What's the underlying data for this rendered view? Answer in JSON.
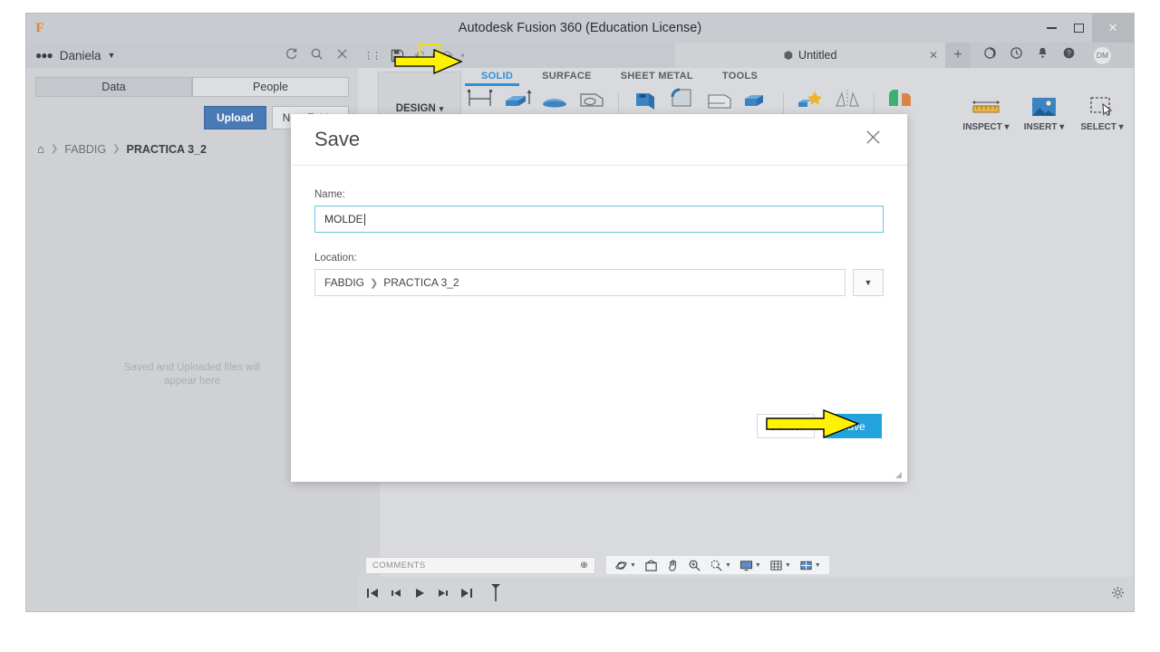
{
  "window": {
    "title": "Autodesk Fusion 360 (Education License)",
    "logo": "F",
    "minimize": "—",
    "maximize": "□",
    "close": "✕"
  },
  "data_panel": {
    "user": "Daniela",
    "user_caret": "▼",
    "people_icon": "people-icon",
    "refresh_icon": "refresh-icon",
    "search_icon": "search-icon",
    "close_icon": "close-icon",
    "tabs": [
      {
        "label": "Data",
        "active": true
      },
      {
        "label": "People",
        "active": false
      }
    ],
    "upload_label": "Upload",
    "new_folder_label": "New Folder",
    "breadcrumb": {
      "home": "⌂",
      "sep": "❯",
      "items": [
        "FABDIG",
        "PRACTICA 3_2"
      ]
    },
    "empty_line1": "Saved and Uploaded files will",
    "empty_line2": "appear here"
  },
  "quick_access": {
    "grip": "⋮⋮",
    "save_icon": "save-icon",
    "undo_label": "↶",
    "redo_label": "↷",
    "caret": "▾"
  },
  "doc_tabs": {
    "tab_label": "Untitled",
    "tab_cube_icon": "cube-icon",
    "tab_close": "✕",
    "new_tab": "+",
    "icons": [
      "sync-icon",
      "history-icon",
      "notification-bell-icon",
      "help-icon"
    ],
    "avatar_initials": "DM"
  },
  "ribbon": {
    "design_label": "DESIGN",
    "design_caret": "▾",
    "tabs": [
      {
        "label": "SOLID",
        "active": true
      },
      {
        "label": "SURFACE",
        "active": false
      },
      {
        "label": "SHEET METAL",
        "active": false
      },
      {
        "label": "TOOLS",
        "active": false
      }
    ],
    "right_buttons": [
      {
        "label": "INSPECT ▾",
        "icon": "ruler-icon"
      },
      {
        "label": "INSERT ▾",
        "icon": "image-icon"
      },
      {
        "label": "SELECT ▾",
        "icon": "selection-box-icon"
      }
    ]
  },
  "bottom": {
    "comments_label": "COMMENTS",
    "comments_add": "⊕",
    "view_tools": [
      "orbit-icon",
      "pan-box-icon",
      "pan-hand-icon",
      "zoom-fit-icon",
      "zoom-window-icon",
      "display-settings-icon",
      "grid-settings-icon",
      "viewport-layout-icon"
    ],
    "timeline_buttons": [
      "skip-start-icon",
      "step-back-icon",
      "play-icon",
      "step-forward-icon",
      "skip-end-icon"
    ],
    "timeline_marker": "marker-icon",
    "settings_gear": "gear-icon"
  },
  "dialog": {
    "title": "Save",
    "close": "✕",
    "name_label": "Name:",
    "name_value": "MOLDE",
    "location_label": "Location:",
    "location_root": "FABDIG",
    "location_sep": "❯",
    "location_folder": "PRACTICA 3_2",
    "location_dropdown": "▼",
    "cancel_label": "Cancel",
    "save_label": "Save",
    "resize_grip": "◢"
  },
  "annotations": {
    "arrow_color": "#FFF200",
    "arrow_stroke": "#000000",
    "highlight_color": "#F2E008",
    "arrow_toolbar_target": "save-icon",
    "arrow_dialog_target": "save-button"
  }
}
